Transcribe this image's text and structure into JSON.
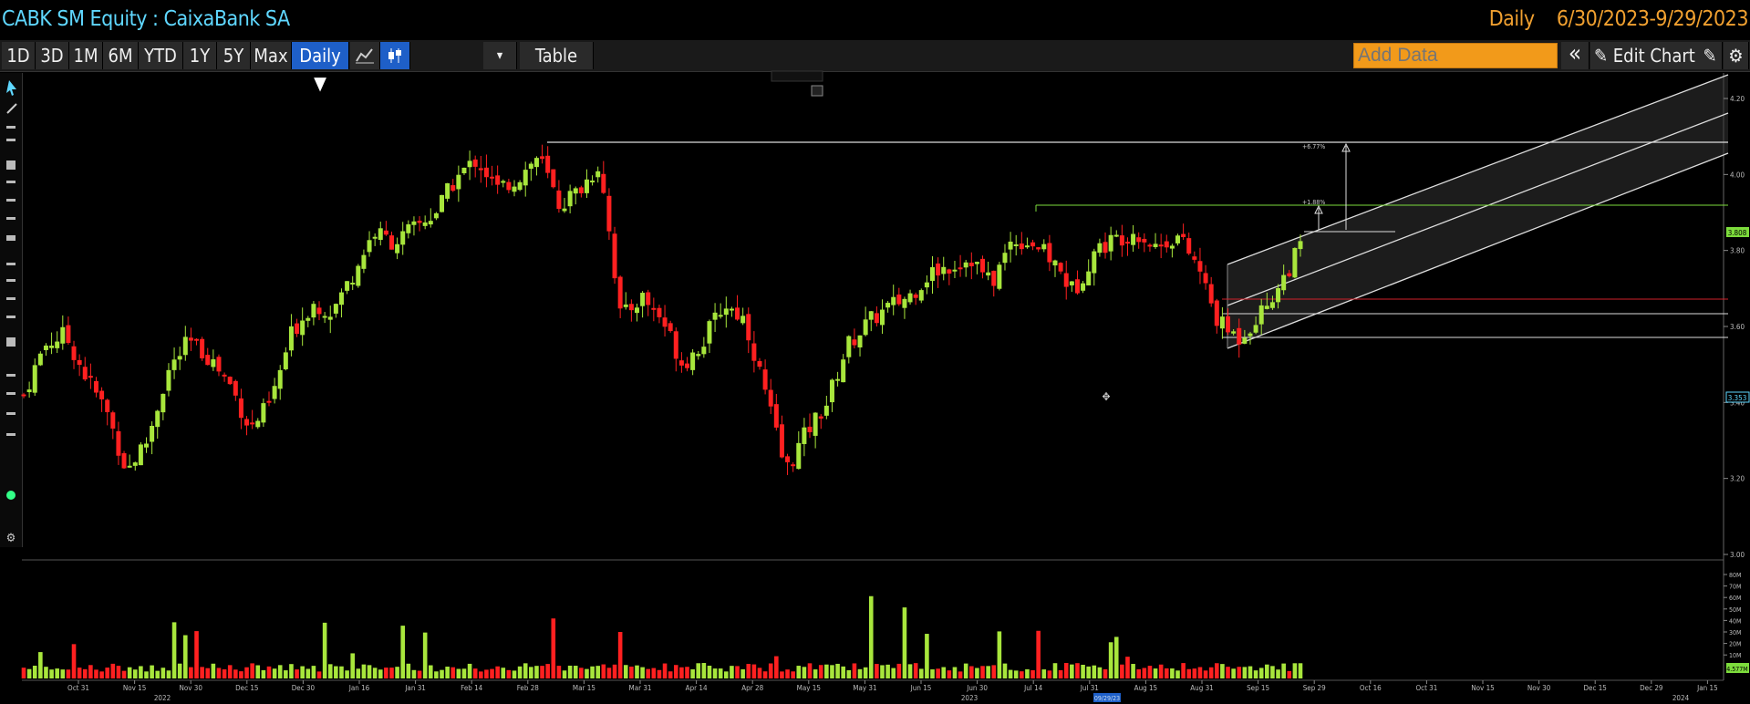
{
  "header": {
    "security": "CABK SM Equity : CaixaBank SA",
    "period": "Daily",
    "date_range": "6/30/2023-9/29/2023"
  },
  "toolbar": {
    "ranges": [
      "1D",
      "3D",
      "1M",
      "6M",
      "YTD",
      "1Y",
      "5Y",
      "Max"
    ],
    "frequency": "Daily ▼",
    "dropdown": "▾",
    "table_label": "Table",
    "add_data_placeholder": "Add Data",
    "collapse": "«",
    "edit_chart_label": "Edit Chart"
  },
  "icons": [
    "cursor-icon",
    "line-chart-icon",
    "candlestick-icon",
    "pencil-icon",
    "settings-icon",
    "collapse-icon",
    "edit-icon"
  ],
  "colors": {
    "up": "#a8e63c",
    "down": "#ff2020",
    "accent": "#f29a1a",
    "title": "#5fd7ff",
    "active": "#1e5fc8"
  },
  "chart_data": {
    "type": "candlestick",
    "price_axis": [
      "4.20",
      "4.00",
      "3.80",
      "3.60",
      "3.40",
      "3.20",
      "3.00"
    ],
    "price_markers": [
      "3.808",
      "3.353"
    ],
    "volume_axis": [
      "80M",
      "70M",
      "60M",
      "50M",
      "40M",
      "30M",
      "20M",
      "10M"
    ],
    "volume_marker": "4.577M",
    "x_labels": [
      "Oct 31",
      "Nov 15",
      "Nov 30",
      "Dec 15",
      "Dec 30",
      "Jan 16",
      "Jan 31",
      "Feb 14",
      "Feb 28",
      "Mar 15",
      "Mar 31",
      "Apr 14",
      "Apr 28",
      "May 15",
      "May 31",
      "Jun 15",
      "Jun 30",
      "Jul 14",
      "Jul 31",
      "Aug 15",
      "Aug 31",
      "Sep 15",
      "Sep 29",
      "Oct 16",
      "Oct 31",
      "Nov 15",
      "Nov 30",
      "Dec 15",
      "Dec 29",
      "Jan 15"
    ],
    "year_labels": [
      "2022",
      "2023",
      "2024"
    ],
    "highlight_date": "09/29/23",
    "annotations": [
      "+6.77%",
      "+1.88%"
    ],
    "closes": [
      3.42,
      3.55,
      3.58,
      3.47,
      3.38,
      3.22,
      3.3,
      3.48,
      3.56,
      3.52,
      3.45,
      3.33,
      3.4,
      3.58,
      3.66,
      3.64,
      3.74,
      3.85,
      3.82,
      3.86,
      3.9,
      3.99,
      4.04,
      3.96,
      3.99,
      4.05,
      3.92,
      3.96,
      4.03,
      3.62,
      3.68,
      3.62,
      3.5,
      3.56,
      3.66,
      3.62,
      3.43,
      3.22,
      3.32,
      3.4,
      3.55,
      3.61,
      3.65,
      3.68,
      3.74,
      3.76,
      3.78,
      3.71,
      3.83,
      3.82,
      3.77,
      3.69,
      3.8,
      3.83,
      3.85,
      3.81,
      3.84,
      3.76,
      3.61,
      3.57,
      3.63,
      3.71,
      3.81
    ]
  }
}
